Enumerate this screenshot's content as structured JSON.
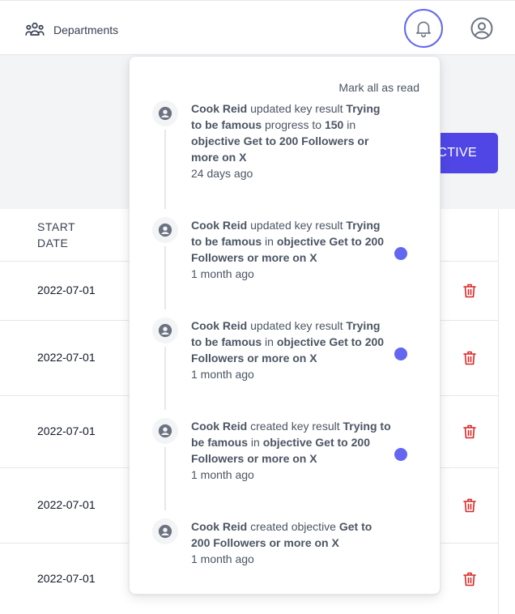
{
  "header": {
    "departments_label": "Departments",
    "bell_icon": "bell-icon",
    "user_icon": "user-circle-icon",
    "accent_color": "#6366f1"
  },
  "page": {
    "create_objective_partial": "CTIVE",
    "table": {
      "start_date_header_line1": "START",
      "start_date_header_line2": "DATE",
      "rows": [
        {
          "start_date": "2022-07-01"
        },
        {
          "start_date": "2022-07-01"
        },
        {
          "start_date": "2022-07-01"
        },
        {
          "start_date": "2022-07-01"
        },
        {
          "start_date": "2022-07-01"
        }
      ],
      "delete_icon": "trash-icon",
      "delete_color": "#dc2626"
    }
  },
  "notifications": {
    "mark_all_read": "Mark all as read",
    "items": [
      {
        "actor": "Cook Reid",
        "action": "updated key result",
        "key_result": "Trying to be famous",
        "middle": "progress to",
        "value": "150",
        "in": "in",
        "objective_word": "objective",
        "objective": "Get to 200 Followers or more on X",
        "time": "24 days ago",
        "unread": false
      },
      {
        "actor": "Cook Reid",
        "action": "updated key result",
        "key_result": "Trying to be famous",
        "in": "in",
        "objective_word": "objective",
        "objective": "Get to 200 Followers or more on X",
        "time": "1 month ago",
        "unread": true
      },
      {
        "actor": "Cook Reid",
        "action": "updated key result",
        "key_result": "Trying to be famous",
        "in": "in",
        "objective_word": "objective",
        "objective": "Get to 200 Followers or more on X",
        "time": "1 month ago",
        "unread": true
      },
      {
        "actor": "Cook Reid",
        "action": "created key result",
        "key_result": "Trying to be famous",
        "in": "in",
        "objective_word": "objective",
        "objective": "Get to 200 Followers or more on X",
        "time": "1 month ago",
        "unread": true
      },
      {
        "actor": "Cook Reid",
        "action": "created objective",
        "objective": "Get to 200 Followers or more on X",
        "time": "1 month ago",
        "unread": false
      }
    ]
  }
}
